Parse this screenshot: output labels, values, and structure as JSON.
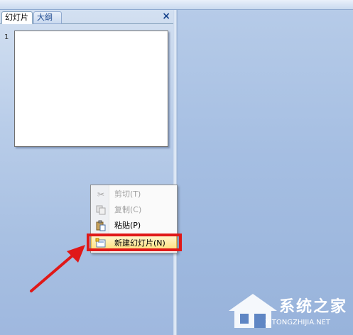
{
  "tabs": [
    {
      "label": "幻灯片",
      "active": true
    },
    {
      "label": "大纲",
      "active": false
    }
  ],
  "close_glyph": "×",
  "slides": [
    {
      "number": "1"
    }
  ],
  "context_menu": {
    "items": [
      {
        "label": "剪切(T)",
        "icon": "scissors-icon",
        "enabled": false
      },
      {
        "label": "复制(C)",
        "icon": "copy-icon",
        "enabled": false
      },
      {
        "label": "粘贴(P)",
        "icon": "paste-icon",
        "enabled": true
      },
      {
        "label": "新建幻灯片(N)",
        "icon": "new-slide-icon",
        "enabled": true,
        "highlighted": true
      }
    ]
  },
  "watermark": {
    "title": "系统之家",
    "subtitle": "XITONGZHIJIA.NET"
  },
  "colors": {
    "annotation_red": "#e01818",
    "menu_highlight": "#ffdf7a",
    "pane_blue": "#a8c0e2"
  }
}
